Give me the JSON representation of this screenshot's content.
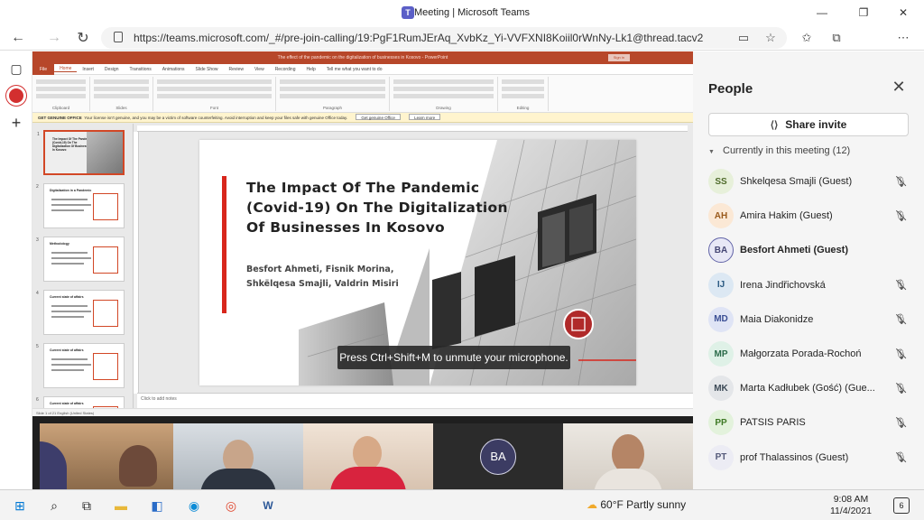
{
  "window": {
    "title": "Meeting | Microsoft Teams"
  },
  "browser": {
    "url": "https://teams.microsoft.com/_#/pre-join-calling/19:PgF1RumJErAq_XvbKz_Yi-VVFXNI8Koiil0rWnNy-Lk1@thread.tacv2"
  },
  "ppt": {
    "window_title": "The effect of the pandemic on the digitalization of businesses in Kosovo  -  PowerPoint",
    "sign_in": "Sign in",
    "tabs": [
      "File",
      "Home",
      "Insert",
      "Design",
      "Transitions",
      "Animations",
      "Slide Show",
      "Review",
      "View",
      "Recording",
      "Help",
      "Tell me what you want to do"
    ],
    "ribbon_groups": [
      "Clipboard",
      "Slides",
      "Font",
      "Paragraph",
      "Drawing",
      "Editing"
    ],
    "warning": {
      "label": "GET GENUINE OFFICE",
      "text": "Your license isn't genuine, and you may be a victim of software counterfeiting. Avoid interruption and keep your files safe with genuine Office today.",
      "btn1": "Get genuine Office",
      "btn2": "Learn more"
    },
    "notes_placeholder": "Click to add notes",
    "status_text": "Slide 1 of 21    English (United States)",
    "slide": {
      "title": "The Impact Of The Pandemic (Covid-19) On The Digitalization Of Businesses In Kosovo",
      "authors": "Besfort Ahmeti, Fisnik Morina, Shkëlqesa Smajli, Valdrin Misiri"
    },
    "thumbnails": [
      {
        "num": "1",
        "heading": "The Impact Of The Pandemic (Covid-19) On The Digitalization Of Businesses In Kosovo"
      },
      {
        "num": "2",
        "heading": "Digitalization in a Pandemic"
      },
      {
        "num": "3",
        "heading": "Methodology"
      },
      {
        "num": "4",
        "heading": "Current state of affairs"
      },
      {
        "num": "5",
        "heading": "Current state of affairs"
      },
      {
        "num": "6",
        "heading": "Current state of affairs"
      }
    ]
  },
  "toast": "Press Ctrl+Shift+M to unmute your microphone.",
  "people": {
    "title": "People",
    "share_label": "Share invite",
    "section_label": "Currently in this meeting (12)",
    "participants": [
      {
        "initials": "SS",
        "name": "Shkelqesa Smajli (Guest)",
        "bg": "#e7f0da",
        "fg": "#4f6b2b",
        "muted": true,
        "bold": false
      },
      {
        "initials": "AH",
        "name": "Amira Hakim (Guest)",
        "bg": "#fbe8d5",
        "fg": "#9a5a1c",
        "muted": true,
        "bold": false
      },
      {
        "initials": "BA",
        "name": "Besfort Ahmeti (Guest)",
        "bg": "#e8e8f6",
        "fg": "#464775",
        "muted": false,
        "bold": true
      },
      {
        "initials": "IJ",
        "name": "Irena Jindřichovská",
        "bg": "#dce8f3",
        "fg": "#2b5a82",
        "muted": true,
        "bold": false
      },
      {
        "initials": "MD",
        "name": "Maia Diakonidze",
        "bg": "#dfe4f5",
        "fg": "#3b4f95",
        "muted": true,
        "bold": false
      },
      {
        "initials": "MP",
        "name": "Małgorzata Porada-Rochoń",
        "bg": "#dff1e7",
        "fg": "#2b6b4a",
        "muted": true,
        "bold": false
      },
      {
        "initials": "MK",
        "name": "Marta Kadłubek (Gość) (Gue...",
        "bg": "#e4e6e9",
        "fg": "#3c4a57",
        "muted": true,
        "bold": false
      },
      {
        "initials": "PP",
        "name": "PATSIS PARIS",
        "bg": "#e3f2dc",
        "fg": "#3f7a26",
        "muted": true,
        "bold": false
      },
      {
        "initials": "PT",
        "name": "prof Thalassinos (Guest)",
        "bg": "#ececf4",
        "fg": "#555a7a",
        "muted": true,
        "bold": false
      }
    ]
  },
  "video": {
    "avatar_initials": "BA"
  },
  "taskbar": {
    "weather": "60°F  Partly sunny",
    "time": "9:08 AM",
    "date": "11/4/2021",
    "notifications": "6"
  }
}
